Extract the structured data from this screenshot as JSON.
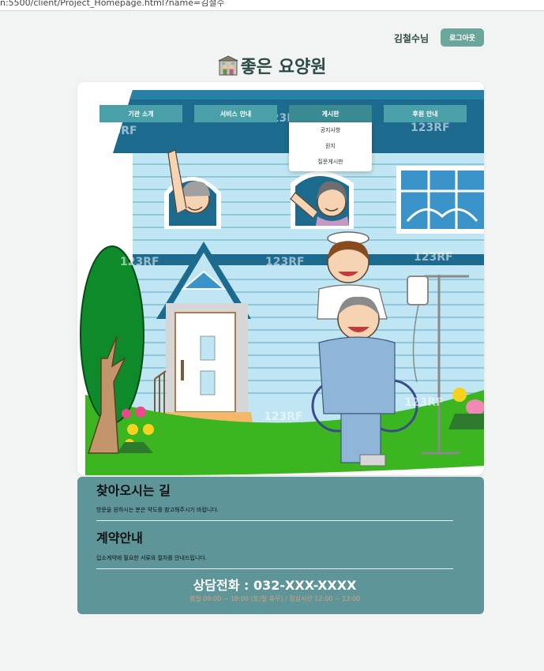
{
  "browser": {
    "url": "n:5500/client/Project_Homepage.html?name=김철수"
  },
  "header": {
    "user_label": "김철수님",
    "logout_label": "로그아웃",
    "site_title": "좋은 요양원",
    "title_icon": "building-with-family-icon"
  },
  "nav": {
    "items": [
      {
        "label": "기관 소개"
      },
      {
        "label": "서비스 안내"
      },
      {
        "label": "게시판"
      },
      {
        "label": "후원 안내"
      }
    ],
    "active_index": 2,
    "dropdown": [
      "공지사항",
      "원지",
      "질문게시판"
    ]
  },
  "hero": {
    "watermark": "123RF"
  },
  "info": {
    "directions_title": "찾아오시는 길",
    "directions_desc": "방문을 원하시는 분은 약도를 참고해주시기 바랍니다.",
    "contract_title": "계약안내",
    "contract_desc": "입소계약에 필요한 서류와 절차를 안내드립니다.",
    "phone": "상담전화 : 032-XXX-XXXX",
    "hours": "평일 09:00 ~ 18:00 (토/일 휴무) / 점심시간 12:00 ~ 13:00"
  },
  "colors": {
    "accent": "#6aa699",
    "nav": "#4aa0a8",
    "footer_panel": "#5e9598",
    "title_text": "#2c4a44"
  }
}
